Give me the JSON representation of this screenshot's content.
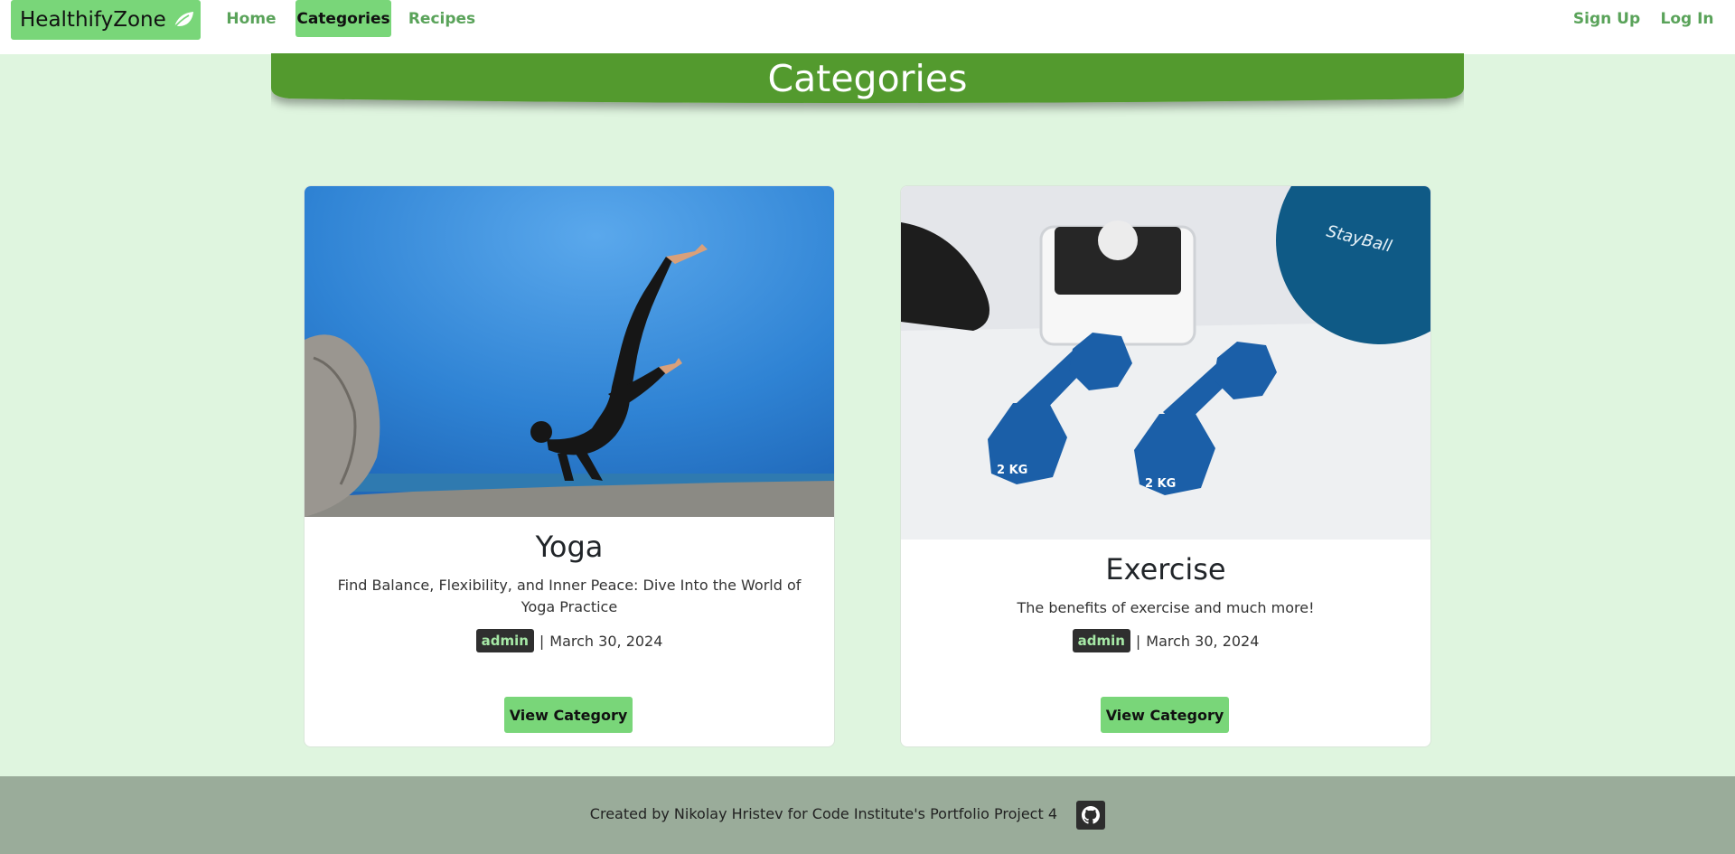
{
  "nav": {
    "brand": "HealthifyZone",
    "links": [
      {
        "label": "Home"
      },
      {
        "label": "Categories",
        "active": true
      },
      {
        "label": "Recipes"
      }
    ],
    "auth": [
      {
        "label": "Sign Up"
      },
      {
        "label": "Log In"
      }
    ]
  },
  "header": {
    "title": "Categories"
  },
  "cards": [
    {
      "title": "Yoga",
      "description": "Find Balance, Flexibility, and Inner Peace: Dive Into the World of Yoga Practice",
      "author": "admin",
      "separator": "|",
      "date": "March 30, 2024",
      "button": "View Category"
    },
    {
      "title": "Exercise",
      "description": "The benefits of exercise and much more!",
      "author": "admin",
      "separator": "|",
      "date": "March 30, 2024",
      "button": "View Category",
      "image_text": {
        "dumbbell_weight": "2 KG",
        "ball_brand": "StayBall"
      }
    }
  ],
  "footer": {
    "text": "Created by Nikolay Hristev for Code Institute's Portfolio Project 4",
    "github_icon": "github-icon"
  },
  "colors": {
    "accent": "#79d679",
    "banner": "#529a2e",
    "page_bg": "#dff5df",
    "footer_bg": "#9aac9a",
    "badge_bg": "#2f2f2f"
  }
}
